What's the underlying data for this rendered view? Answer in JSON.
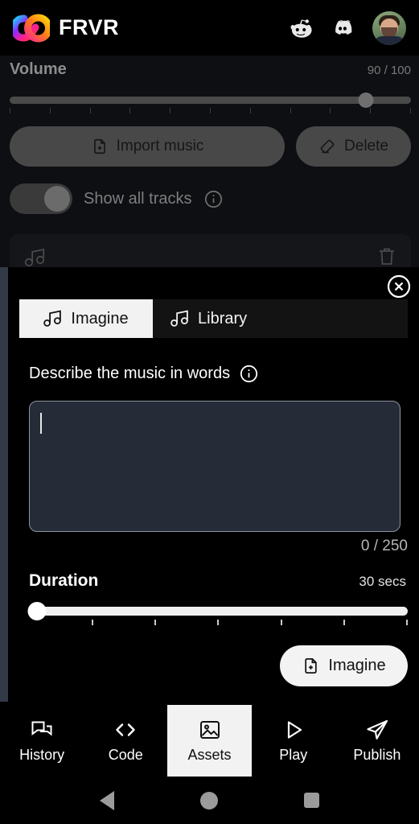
{
  "topbar": {
    "brand_name": "FRVR",
    "icons": [
      {
        "name": "reddit-icon",
        "label": "Reddit"
      },
      {
        "name": "discord-icon",
        "label": "Discord"
      }
    ],
    "avatar_label": "User avatar"
  },
  "background_panel": {
    "volume": {
      "label": "Volume",
      "value_text": "90 / 100",
      "value": 90,
      "max": 100,
      "tick_count": 11
    },
    "buttons": {
      "import_label": "Import music",
      "delete_label": "Delete"
    },
    "show_all_tracks": {
      "label": "Show all tracks",
      "enabled": false,
      "info_icon": "info-icon"
    },
    "track_card": {
      "music_icon": "music-note-icon",
      "delete_icon": "trash-icon"
    }
  },
  "modal": {
    "close_icon": "close-icon",
    "tabs": [
      {
        "label": "Imagine",
        "icon": "music-note-icon",
        "active": true
      },
      {
        "label": "Library",
        "icon": "music-note-icon",
        "active": false
      }
    ],
    "prompt": {
      "label": "Describe the music in words",
      "info_icon": "info-icon",
      "value": "",
      "placeholder": "",
      "counter": "0 / 250",
      "max_chars": 250
    },
    "duration": {
      "label": "Duration",
      "value_text": "30 secs",
      "value": 30,
      "tick_count": 6
    },
    "submit": {
      "label": "Imagine",
      "icon": "file-plus-icon"
    }
  },
  "bottom_nav": [
    {
      "label": "History",
      "icon": "chat-bubbles-icon",
      "active": false
    },
    {
      "label": "Code",
      "icon": "code-brackets-icon",
      "active": false
    },
    {
      "label": "Assets",
      "icon": "image-icon",
      "active": true
    },
    {
      "label": "Play",
      "icon": "play-triangle-icon",
      "active": false
    },
    {
      "label": "Publish",
      "icon": "paper-plane-icon",
      "active": false
    }
  ],
  "system_nav": {
    "back": "back-triangle-icon",
    "home": "home-circle-icon",
    "recents": "recents-square-icon"
  },
  "colors": {
    "background": "#000000",
    "accent_white": "#f2f2f2",
    "textarea_bg": "#262b38",
    "rail": "#333a47"
  }
}
